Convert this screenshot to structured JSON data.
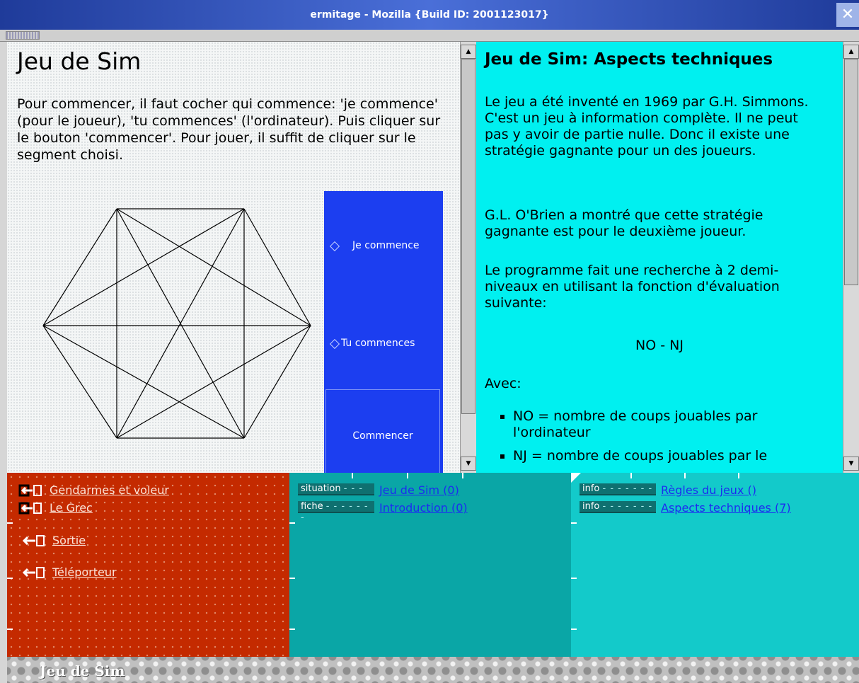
{
  "window": {
    "title": "ermitage - Mozilla {Build ID: 2001123017}",
    "close_glyph": "✕"
  },
  "left_frame": {
    "heading": "Jeu de Sim",
    "instructions": "Pour commencer, il faut cocher qui commence: 'je commence' (pour le joueur), 'tu commences' (l'ordinateur). Puis cliquer sur le bouton 'commencer'. Pour jouer, il suffit de cliquer sur le segment choisi.",
    "options": [
      {
        "label": "Je commence"
      },
      {
        "label": "Tu commences"
      }
    ],
    "start_button": "Commencer",
    "hexagon_edges": 15
  },
  "right_frame": {
    "heading": "Jeu de Sim: Aspects techniques",
    "paragraph1": "Le jeu a été inventé en 1969 par G.H. Simmons. C'est un jeu à information complète. Il ne peut pas y avoir de partie nulle. Donc il existe une stratégie gagnante pour un des joueurs.",
    "paragraph2": "G.L. O'Brien a montré que cette stratégie gagnante est pour le deuxième joueur.",
    "paragraph3": "Le programme fait une recherche à 2 demi-niveaux en utilisant la fonction d'évaluation suivante:",
    "formula": "NO - NJ",
    "avec": "Avec:",
    "bullets": [
      "NO = nombre de coups jouables par l'ordinateur",
      "NJ = nombre de coups jouables par le"
    ]
  },
  "nav_panel": {
    "links": [
      "Gendarmes et voleur",
      "Le Grec",
      "Sortie",
      "Téléporteur"
    ]
  },
  "middle_panel": {
    "rows": [
      {
        "tag": "situation",
        "dots": "- - -",
        "link": "Jeu de Sim (0)"
      },
      {
        "tag": "fiche",
        "dots": "- - - - - - -",
        "link": "Introduction (0)"
      }
    ]
  },
  "right_panel": {
    "rows": [
      {
        "tag": "info",
        "dots": "- - - - - - -",
        "link": "Règles du jeux ()"
      },
      {
        "tag": "info",
        "dots": "- - - - - - -",
        "link": "Aspects techniques (7)"
      }
    ]
  },
  "status_bar": {
    "text": "Jeu de Sim"
  },
  "colors": {
    "title_bar": "#2b4bb8",
    "control_panel": "#1c3ef0",
    "right_frame_bg": "#00f0f0",
    "nav_red": "#c42a00",
    "teal_dark": "#0aa6a6",
    "teal_light": "#13caca"
  }
}
